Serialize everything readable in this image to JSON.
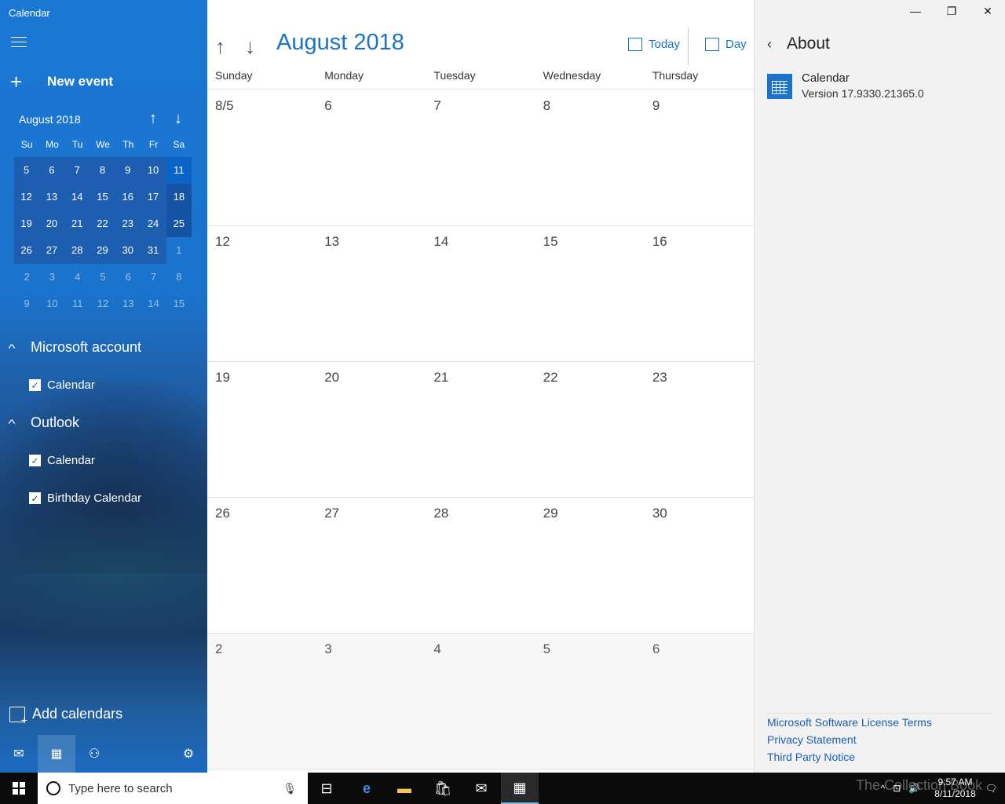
{
  "app": {
    "title": "Calendar"
  },
  "sidebar": {
    "new_event": "New event",
    "mini": {
      "month": "August 2018",
      "dow": [
        "Su",
        "Mo",
        "Tu",
        "We",
        "Th",
        "Fr",
        "Sa"
      ],
      "weeks": [
        [
          "5",
          "6",
          "7",
          "8",
          "9",
          "10",
          "11"
        ],
        [
          "12",
          "13",
          "14",
          "15",
          "16",
          "17",
          "18"
        ],
        [
          "19",
          "20",
          "21",
          "22",
          "23",
          "24",
          "25"
        ],
        [
          "26",
          "27",
          "28",
          "29",
          "30",
          "31",
          "1"
        ],
        [
          "2",
          "3",
          "4",
          "5",
          "6",
          "7",
          "8"
        ],
        [
          "9",
          "10",
          "11",
          "12",
          "13",
          "14",
          "15"
        ]
      ]
    },
    "groups": [
      {
        "name": "Microsoft account",
        "items": [
          "Calendar"
        ]
      },
      {
        "name": "Outlook",
        "items": [
          "Calendar",
          "Birthday Calendar"
        ]
      }
    ],
    "add_calendars": "Add calendars"
  },
  "main": {
    "month_title": "August 2018",
    "today_label": "Today",
    "view_label": "Day",
    "dow": [
      "Sunday",
      "Monday",
      "Tuesday",
      "Wednesday",
      "Thursday"
    ],
    "weeks": [
      [
        "8/5",
        "6",
        "7",
        "8",
        "9"
      ],
      [
        "12",
        "13",
        "14",
        "15",
        "16"
      ],
      [
        "19",
        "20",
        "21",
        "22",
        "23"
      ],
      [
        "26",
        "27",
        "28",
        "29",
        "30"
      ],
      [
        "2",
        "3",
        "4",
        "5",
        "6"
      ]
    ]
  },
  "about": {
    "title": "About",
    "app_name": "Calendar",
    "version": "Version 17.9330.21365.0",
    "links": [
      "Microsoft Software License Terms",
      "Privacy Statement",
      "Third Party Notice"
    ]
  },
  "taskbar": {
    "search_placeholder": "Type here to search",
    "time": "9:57 AM",
    "date": "8/11/2018"
  },
  "watermark": "The Collection Book",
  "colors": {
    "accent": "#1a73c8",
    "sidebar": "#1a73cc"
  }
}
